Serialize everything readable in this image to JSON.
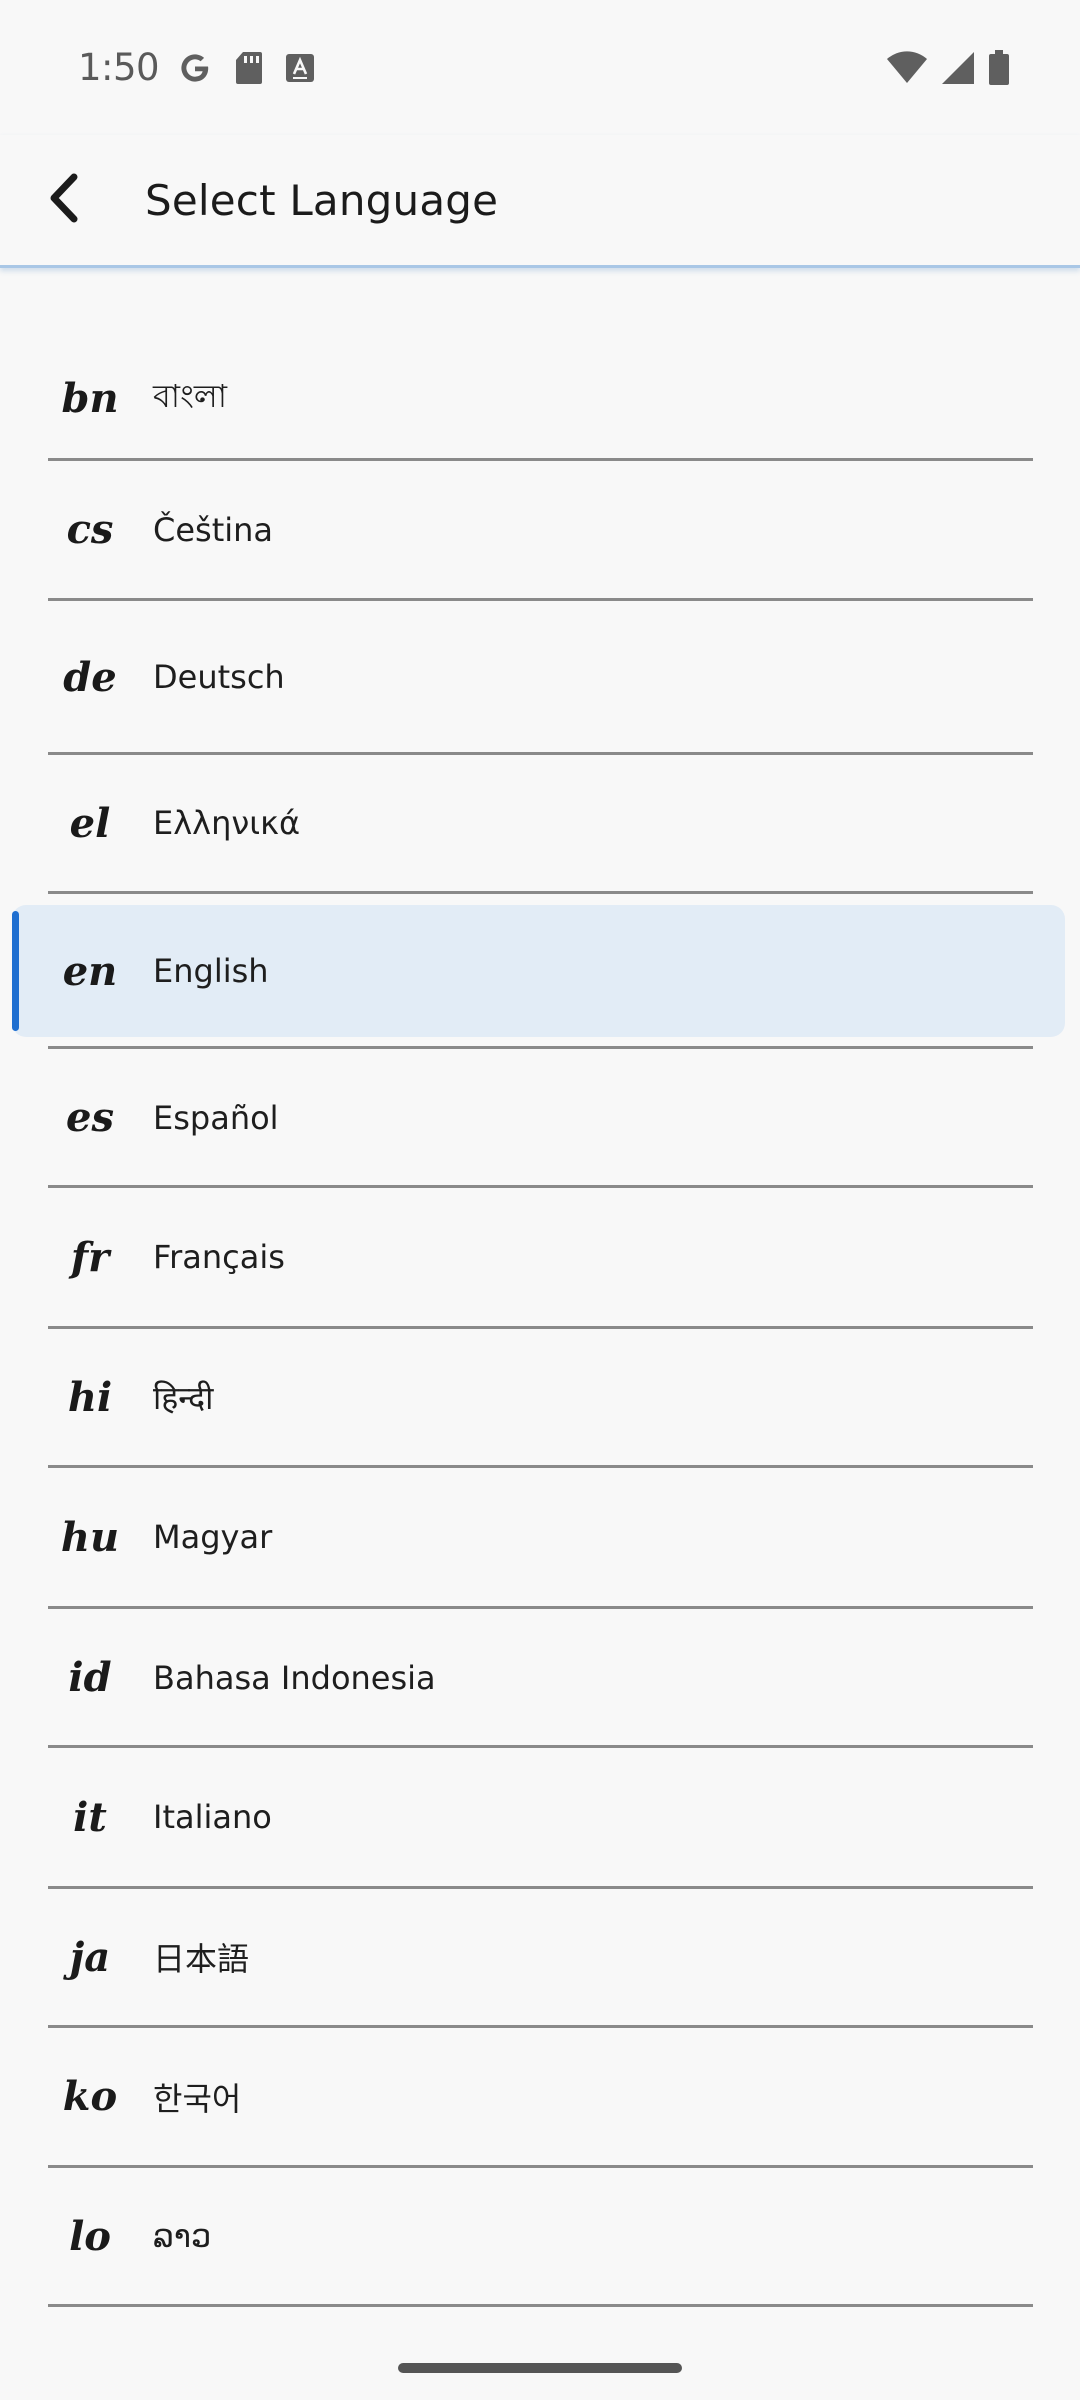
{
  "status_bar": {
    "time": "1:50",
    "left_icons": [
      "google-icon",
      "sd-card-icon",
      "keyboard-a-icon"
    ],
    "right_icons": [
      "wifi-icon",
      "cell-signal-icon",
      "battery-icon"
    ]
  },
  "app_bar": {
    "back_icon": "arrow-back-icon",
    "title": "Select Language"
  },
  "languages": [
    {
      "code": "bn",
      "name": "বাংলা"
    },
    {
      "code": "cs",
      "name": "Čeština"
    },
    {
      "code": "de",
      "name": "Deutsch"
    },
    {
      "code": "el",
      "name": "Ελληνικά"
    },
    {
      "code": "en",
      "name": "English",
      "selected": true
    },
    {
      "code": "es",
      "name": "Español"
    },
    {
      "code": "fr",
      "name": "Français"
    },
    {
      "code": "hi",
      "name": "हिन्दी"
    },
    {
      "code": "hu",
      "name": "Magyar"
    },
    {
      "code": "id",
      "name": "Bahasa Indonesia"
    },
    {
      "code": "it",
      "name": "Italiano"
    },
    {
      "code": "ja",
      "name": "日本語"
    },
    {
      "code": "ko",
      "name": "한국어"
    },
    {
      "code": "lo",
      "name": "ລາວ"
    }
  ],
  "colors": {
    "accent": "#1f6fd0",
    "selected_bg": "#e2ecf6",
    "divider": "#8a8a8a"
  }
}
